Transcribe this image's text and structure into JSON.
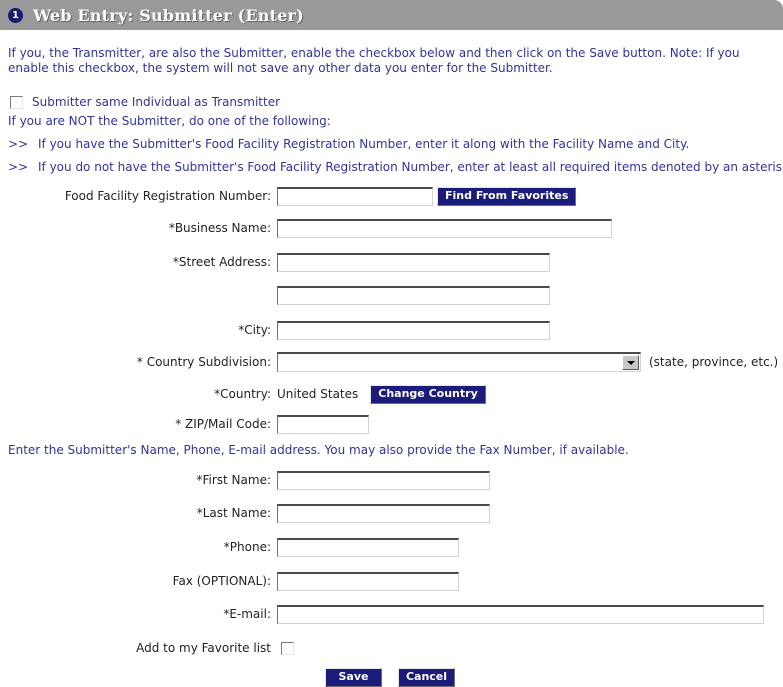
{
  "header": {
    "step_number": "1",
    "title": "Web Entry: Submitter (Enter)",
    "bar_color": "#999999",
    "badge_color": "#1b1b6e"
  },
  "intro": {
    "paragraph": "If you, the Transmitter, are also the Submitter, enable the checkbox below and then click on the Save button. Note: If you enable this checkbox, the system will not save any other data you enter for the Submitter.",
    "same_individual_label": "Submitter same Individual as Transmitter",
    "not_submitter_line": "If you are NOT the Submitter, do one of the following:",
    "bullet_marker": ">>",
    "bullet_1": "If you have the Submitter's Food Facility Registration Number, enter it along with the Facility Name and City.",
    "bullet_2": "If you do not have the Submitter's Food Facility Registration Number, enter at least all required items denoted by an asterisk (*).",
    "name_section_line": "Enter the Submitter's Name, Phone, E-mail address. You may also provide the Fax Number, if available."
  },
  "form": {
    "registration_number": {
      "label": "Food Facility Registration Number:",
      "value": "",
      "button_label": "Find From Favorites"
    },
    "business_name": {
      "label": "*Business Name:",
      "value": ""
    },
    "street_address_1": {
      "label": "*Street Address:",
      "value": ""
    },
    "street_address_2": {
      "label": "",
      "value": ""
    },
    "city": {
      "label": "*City:",
      "value": ""
    },
    "country_subdivision": {
      "label": "* Country Subdivision:",
      "value": "",
      "hint": "(state, province, etc.)"
    },
    "country": {
      "label": "*Country:",
      "value": "United States",
      "button_label": "Change Country"
    },
    "zip_mail_code": {
      "label": "* ZIP/Mail Code:",
      "value": ""
    },
    "first_name": {
      "label": "*First Name:",
      "value": ""
    },
    "last_name": {
      "label": "*Last Name:",
      "value": ""
    },
    "phone": {
      "label": "*Phone:",
      "value": ""
    },
    "fax": {
      "label": "Fax (OPTIONAL):",
      "value": ""
    },
    "email": {
      "label": "*E-mail:",
      "value": ""
    },
    "add_favorite": {
      "label": "Add to my Favorite list"
    }
  },
  "actions": {
    "save_label": "Save",
    "cancel_label": "Cancel",
    "button_color": "#1b1b7a"
  }
}
